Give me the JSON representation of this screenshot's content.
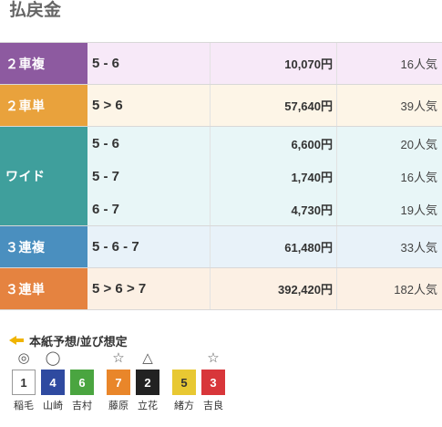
{
  "title": "払戻金",
  "payouts": [
    {
      "type": "２車複",
      "color": "#8d5aa0",
      "bg": "#f7e9f8",
      "tight": false,
      "entries": [
        {
          "combo": "5 - 6",
          "amount": "10,070円",
          "popularity": "16人気"
        }
      ]
    },
    {
      "type": "２車単",
      "color": "#e9a23c",
      "bg": "#fdf5e7",
      "tight": false,
      "entries": [
        {
          "combo": "5 > 6",
          "amount": "57,640円",
          "popularity": "39人気"
        }
      ]
    },
    {
      "type": "ワイド",
      "color": "#3f9f9c",
      "bg": "#e8f6f7",
      "tight": true,
      "entries": [
        {
          "combo": "5 - 6",
          "amount": "6,600円",
          "popularity": "20人気"
        },
        {
          "combo": "5 - 7",
          "amount": "1,740円",
          "popularity": "16人気"
        },
        {
          "combo": "6 - 7",
          "amount": "4,730円",
          "popularity": "19人気"
        }
      ]
    },
    {
      "type": "３連複",
      "color": "#4a8fbf",
      "bg": "#e8f2f9",
      "tight": false,
      "entries": [
        {
          "combo": "5 - 6 - 7",
          "amount": "61,480円",
          "popularity": "33人気"
        }
      ]
    },
    {
      "type": "３連単",
      "color": "#e58340",
      "bg": "#fcf0e4",
      "tight": false,
      "entries": [
        {
          "combo": "5 > 6 > 7",
          "amount": "392,420円",
          "popularity": "182人気"
        }
      ]
    }
  ],
  "prediction": {
    "heading": "本紙予想/並び想定",
    "riders": [
      {
        "mark": "◎",
        "number": "1",
        "name": "稲毛",
        "bg": "#ffffff",
        "fg": "#333333",
        "border": "#999999"
      },
      {
        "mark": "◯",
        "number": "4",
        "name": "山崎",
        "bg": "#2f4aa0",
        "fg": "#ffffff",
        "border": "#2f4aa0"
      },
      {
        "mark": "",
        "number": "6",
        "name": "吉村",
        "bg": "#4aa540",
        "fg": "#ffffff",
        "border": "#4aa540"
      },
      {
        "mark": "☆",
        "number": "7",
        "name": "藤原",
        "bg": "#e9862a",
        "fg": "#ffffff",
        "border": "#e9862a"
      },
      {
        "mark": "△",
        "number": "2",
        "name": "立花",
        "bg": "#222222",
        "fg": "#ffffff",
        "border": "#222222"
      },
      {
        "mark": "",
        "number": "5",
        "name": "緒方",
        "bg": "#e8c832",
        "fg": "#333333",
        "border": "#e8c832"
      },
      {
        "mark": "☆",
        "number": "3",
        "name": "吉良",
        "bg": "#d8363a",
        "fg": "#ffffff",
        "border": "#d8363a"
      }
    ]
  }
}
